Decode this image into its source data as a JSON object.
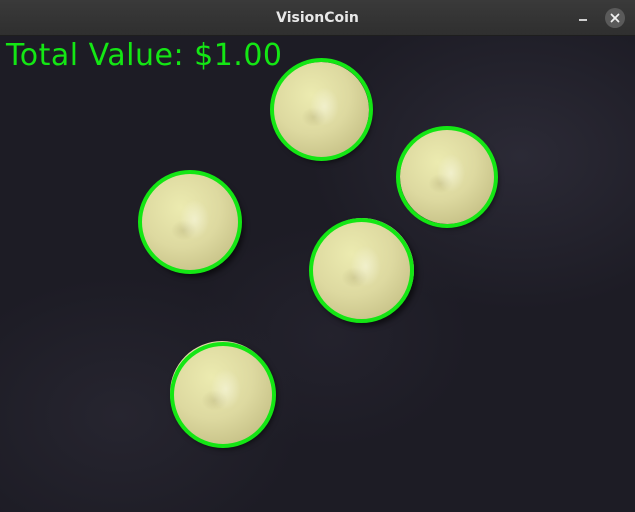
{
  "window": {
    "title": "VisionCoin",
    "minimize_icon": "minimize-icon",
    "close_icon": "close-icon"
  },
  "overlay": {
    "total_label": "Total Value: $1.00",
    "detection_color": "#14e614"
  },
  "detections": [
    {
      "name": "coin-1"
    },
    {
      "name": "coin-2"
    },
    {
      "name": "coin-3"
    },
    {
      "name": "coin-4"
    },
    {
      "name": "coin-5"
    }
  ]
}
